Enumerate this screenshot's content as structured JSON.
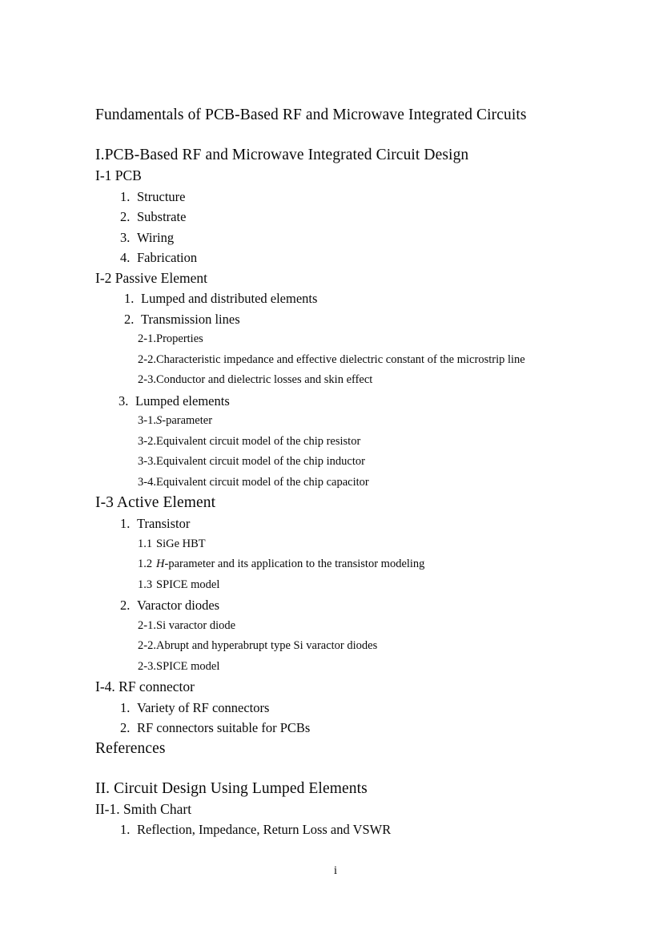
{
  "document": {
    "title": "Fundamentals of PCB-Based RF and Microwave Integrated Circuits",
    "page_number": "i"
  },
  "part_one": {
    "heading": "I.PCB-Based RF and Microwave Integrated Circuit Design",
    "sections": {
      "i1": {
        "heading": "I-1 PCB",
        "items": [
          {
            "num": "1.",
            "label": "Structure"
          },
          {
            "num": "2.",
            "label": "Substrate"
          },
          {
            "num": "3.",
            "label": "Wiring"
          },
          {
            "num": "4.",
            "label": "Fabrication"
          }
        ]
      },
      "i2": {
        "heading": "I-2 Passive Element",
        "item1": {
          "num": "1.",
          "label": "Lumped and distributed elements"
        },
        "item2": {
          "num": "2.",
          "label": "Transmission lines"
        },
        "item2_subs": [
          {
            "num": "2-1.",
            "label": "Properties"
          },
          {
            "num": "2-2.",
            "label": "Characteristic impedance and effective dielectric constant of the microstrip line"
          },
          {
            "num": "2-3.",
            "label": "Conductor and dielectric losses and skin effect"
          }
        ],
        "item3": {
          "num": "3.",
          "label": "Lumped elements"
        },
        "item3_subs": [
          {
            "num": "3-1.",
            "label_italic": "S",
            "label": "-parameter"
          },
          {
            "num": "3-2.",
            "label": "Equivalent circuit model of the chip resistor"
          },
          {
            "num": "3-3.",
            "label": "Equivalent circuit model of the chip inductor"
          },
          {
            "num": "3-4.",
            "label": "Equivalent circuit model of the chip capacitor"
          }
        ]
      },
      "i3": {
        "heading": "I-3 Active Element",
        "item1": {
          "num": "1.",
          "label": "Transistor"
        },
        "item1_subs": [
          {
            "num": "1.1",
            "label": "SiGe HBT"
          },
          {
            "num": "1.2",
            "label_italic": "H",
            "label": "-parameter and its application to the transistor modeling"
          },
          {
            "num": "1.3",
            "label": "SPICE model"
          }
        ],
        "item2": {
          "num": "2.",
          "label": "Varactor diodes"
        },
        "item2_subs": [
          {
            "num": "2-1.",
            "label": "Si varactor diode"
          },
          {
            "num": "2-2.",
            "label": "Abrupt and hyperabrupt type Si varactor diodes"
          },
          {
            "num": "2-3.",
            "label": "SPICE model"
          }
        ]
      },
      "i4": {
        "heading": "I-4. RF connector",
        "items": [
          {
            "num": "1.",
            "label": "Variety of RF connectors"
          },
          {
            "num": "2.",
            "label": "RF connectors suitable for PCBs"
          }
        ]
      }
    },
    "references": "References"
  },
  "part_two": {
    "heading": "II. Circuit Design Using Lumped Elements",
    "sections": {
      "ii1": {
        "heading": "II-1. Smith Chart",
        "items": [
          {
            "num": "1.",
            "label": "Reflection, Impedance, Return Loss and VSWR"
          }
        ]
      }
    }
  }
}
